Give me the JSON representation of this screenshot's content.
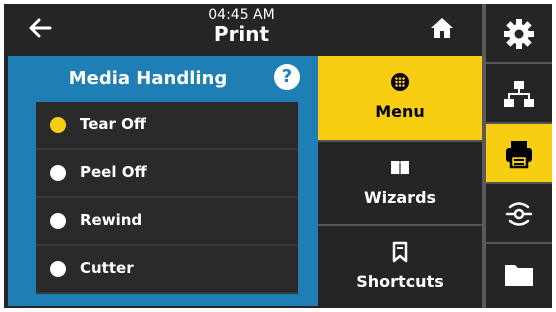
{
  "header": {
    "time": "04:45 AM",
    "title": "Print"
  },
  "panel": {
    "title": "Media Handling",
    "help_label": "?",
    "options": [
      {
        "label": "Tear Off",
        "selected": true
      },
      {
        "label": "Peel Off",
        "selected": false
      },
      {
        "label": "Rewind",
        "selected": false
      },
      {
        "label": "Cutter",
        "selected": false
      }
    ]
  },
  "menu": {
    "items": [
      {
        "label": "Menu",
        "icon": "dots-grid-icon",
        "active": true
      },
      {
        "label": "Wizards",
        "icon": "book-icon",
        "active": false
      },
      {
        "label": "Shortcuts",
        "icon": "bookmark-icon",
        "active": false
      }
    ]
  },
  "sidebar": {
    "icons": [
      "gear-icon",
      "network-icon",
      "printer-icon",
      "wireless-icon",
      "folder-icon"
    ],
    "active": "printer-icon"
  },
  "colors": {
    "accent": "#f7ce11",
    "panel": "#1f7fb4",
    "background": "#252525"
  }
}
